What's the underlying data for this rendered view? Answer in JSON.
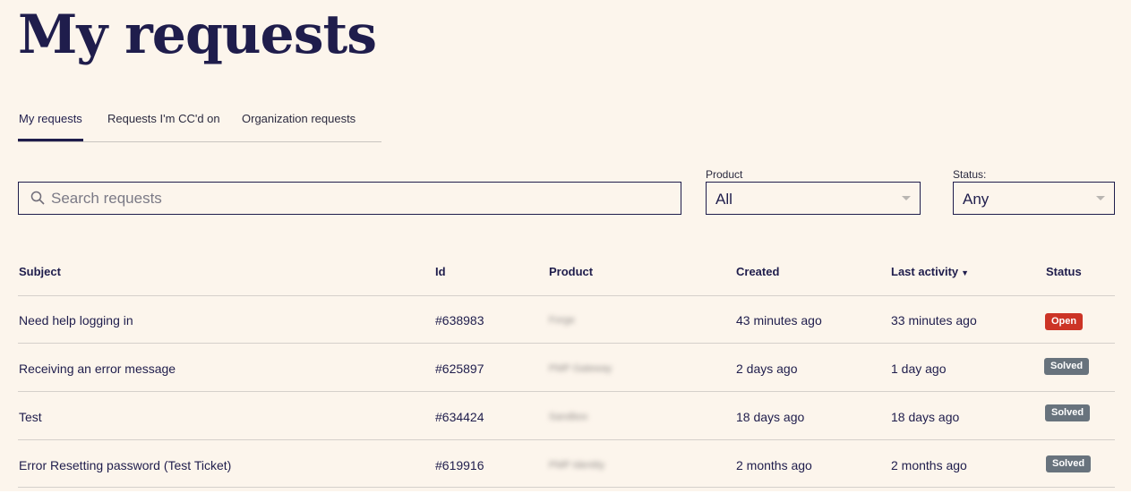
{
  "page": {
    "title": "My requests"
  },
  "tabs": [
    {
      "label": "My requests",
      "active": true
    },
    {
      "label": "Requests I'm CC'd on",
      "active": false
    },
    {
      "label": "Organization requests",
      "active": false
    }
  ],
  "filters": {
    "search_placeholder": "Search requests",
    "product": {
      "label": "Product",
      "value": "All"
    },
    "status": {
      "label": "Status:",
      "value": "Any"
    }
  },
  "table": {
    "headers": {
      "subject": "Subject",
      "id": "Id",
      "product": "Product",
      "created": "Created",
      "last_activity": "Last activity",
      "status": "Status"
    },
    "sort_indicator": "▼",
    "rows": [
      {
        "subject": "Need help logging in",
        "id": "#638983",
        "product": "Forge",
        "created": "43 minutes ago",
        "last_activity": "33 minutes ago",
        "status": "Open"
      },
      {
        "subject": "Receiving an error message",
        "id": "#625897",
        "product": "PMP Gateway",
        "created": "2 days ago",
        "last_activity": "1 day ago",
        "status": "Solved"
      },
      {
        "subject": "Test",
        "id": "#634424",
        "product": "Sandbox",
        "created": "18 days ago",
        "last_activity": "18 days ago",
        "status": "Solved"
      },
      {
        "subject": "Error Resetting password (Test Ticket)",
        "id": "#619916",
        "product": "PMP Identity",
        "created": "2 months ago",
        "last_activity": "2 months ago",
        "status": "Solved"
      }
    ]
  },
  "colors": {
    "background": "#fcf5ec",
    "text": "#1f1d4c",
    "open_badge": "#cc3426",
    "solved_badge": "#68737d"
  }
}
